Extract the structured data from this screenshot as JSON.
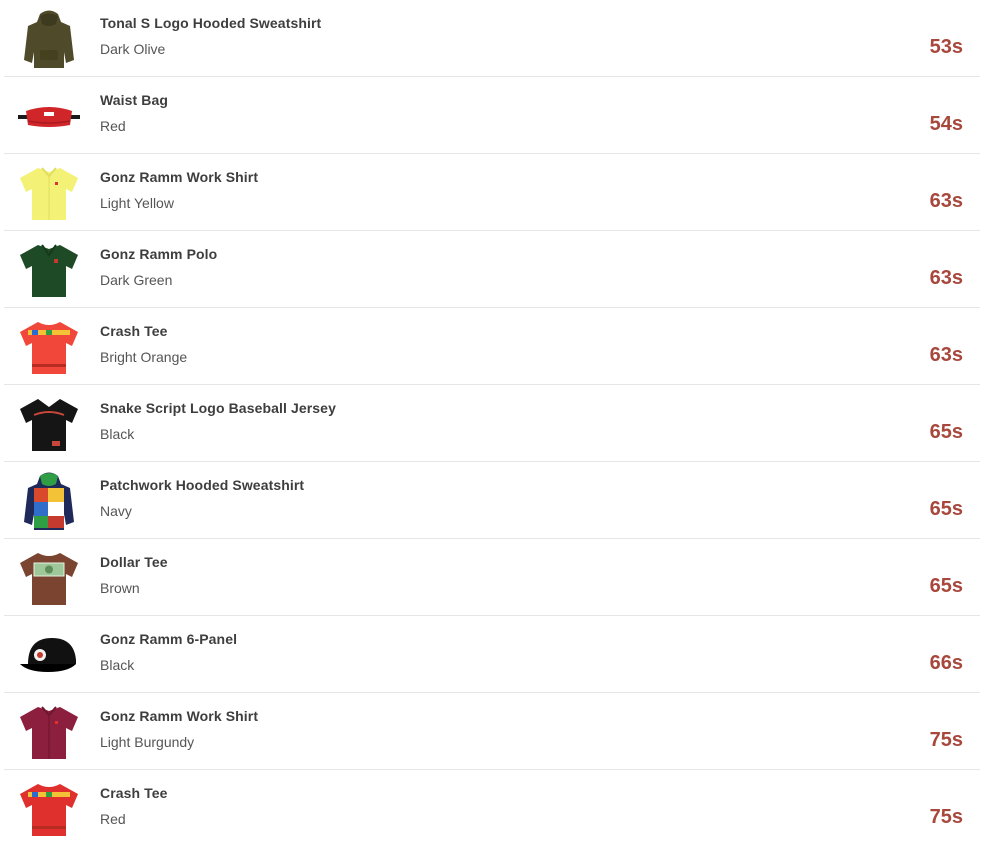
{
  "items": [
    {
      "name": "Tonal S Logo Hooded Sweatshirt",
      "color": "Dark Olive",
      "time": "53s",
      "image_icon": "hooded-sweatshirt-icon",
      "swatch": "#4f4b2a"
    },
    {
      "name": "Waist Bag",
      "color": "Red",
      "time": "54s",
      "image_icon": "waist-bag-icon",
      "swatch": "#d0262a"
    },
    {
      "name": "Gonz Ramm Work Shirt",
      "color": "Light Yellow",
      "time": "63s",
      "image_icon": "work-shirt-icon",
      "swatch": "#f3f276"
    },
    {
      "name": "Gonz Ramm Polo",
      "color": "Dark Green",
      "time": "63s",
      "image_icon": "polo-shirt-icon",
      "swatch": "#1f4a26"
    },
    {
      "name": "Crash Tee",
      "color": "Bright Orange",
      "time": "63s",
      "image_icon": "tee-shirt-icon",
      "swatch": "#f0473a"
    },
    {
      "name": "Snake Script Logo Baseball Jersey",
      "color": "Black",
      "time": "65s",
      "image_icon": "baseball-jersey-icon",
      "swatch": "#151515"
    },
    {
      "name": "Patchwork Hooded Sweatshirt",
      "color": "Navy",
      "time": "65s",
      "image_icon": "patchwork-hoodie-icon",
      "swatch": "#1f2a5a"
    },
    {
      "name": "Dollar Tee",
      "color": "Brown",
      "time": "65s",
      "image_icon": "tee-shirt-icon",
      "swatch": "#7a4431"
    },
    {
      "name": "Gonz Ramm 6-Panel",
      "color": "Black",
      "time": "66s",
      "image_icon": "cap-icon",
      "swatch": "#111111"
    },
    {
      "name": "Gonz Ramm Work Shirt",
      "color": "Light Burgundy",
      "time": "75s",
      "image_icon": "work-shirt-icon",
      "swatch": "#8c1f3d"
    },
    {
      "name": "Crash Tee",
      "color": "Red",
      "time": "75s",
      "image_icon": "tee-shirt-icon",
      "swatch": "#e0302d"
    }
  ]
}
